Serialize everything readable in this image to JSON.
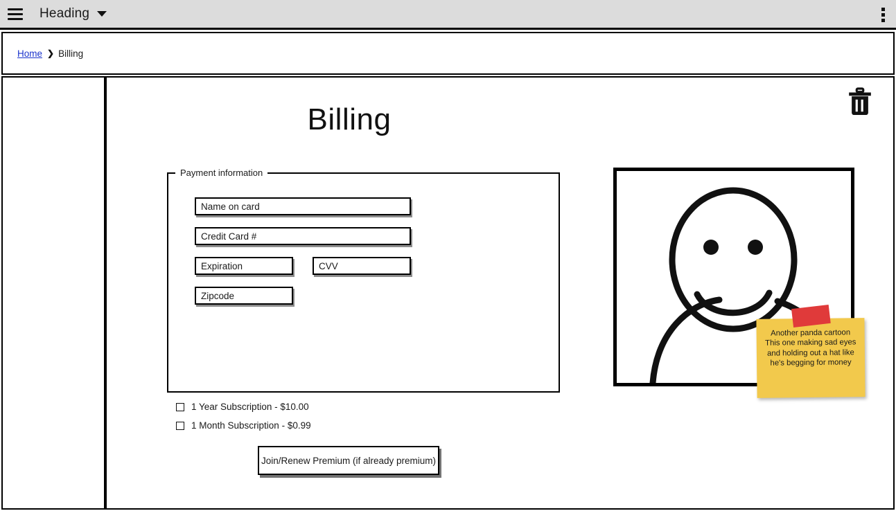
{
  "app_bar": {
    "menu_icon": "hamburger-icon",
    "title": "Heading",
    "caret_icon": "chevron-down-icon",
    "overflow_icon": "kebab-menu-icon"
  },
  "breadcrumb": {
    "home_label": "Home",
    "separator": "❯",
    "current_label": "Billing"
  },
  "content": {
    "delete_icon": "trash-icon",
    "page_title": "Billing",
    "fieldset_legend": "Payment information",
    "fields": [
      {
        "name": "name-on-card",
        "placeholder": "Name on card"
      },
      {
        "name": "credit-card-number",
        "placeholder": "Credit Card #"
      },
      {
        "name": "expiration",
        "placeholder": "Expiration"
      },
      {
        "name": "cvv",
        "placeholder": "CVV"
      },
      {
        "name": "zipcode",
        "placeholder": "Zipcode"
      }
    ],
    "checkboxes": [
      {
        "label": "1 Year Subscription - $10.00",
        "checked": false
      },
      {
        "label": "1 Month Subscription - $0.99",
        "checked": false
      }
    ],
    "primary_button": "Join/Renew Premium (if already premium)"
  },
  "sticky_note": {
    "text": "Another panda cartoon\nThis one making sad eyes and holding out a hat like he's begging for money",
    "note_color": "#f2c94c",
    "tape_color": "#e03a3a"
  },
  "colors": {
    "app_bar_bg": "#dcdcdc",
    "link": "#1a33cc",
    "outline": "#000000",
    "page_bg": "#ffffff"
  }
}
